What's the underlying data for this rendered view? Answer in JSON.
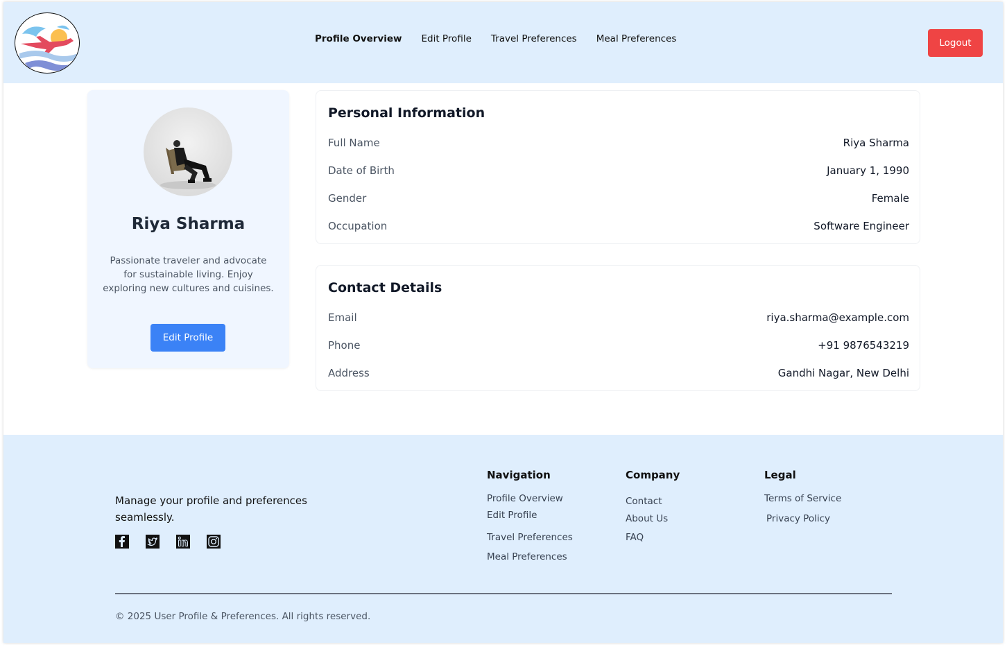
{
  "header": {
    "nav": [
      {
        "label": "Profile Overview",
        "active": true
      },
      {
        "label": "Edit Profile",
        "active": false
      },
      {
        "label": "Travel Preferences",
        "active": false
      },
      {
        "label": "Meal Preferences",
        "active": false
      }
    ],
    "logout_label": "Logout"
  },
  "profile": {
    "name": "Riya Sharma",
    "bio": "Passionate traveler and advocate for sustainable living. Enjoy exploring new cultures and cuisines.",
    "edit_button": "Edit Profile"
  },
  "personal": {
    "title": "Personal Information",
    "rows": [
      {
        "label": "Full Name",
        "value": "Riya Sharma"
      },
      {
        "label": "Date of Birth",
        "value": "January 1, 1990"
      },
      {
        "label": "Gender",
        "value": "Female"
      },
      {
        "label": "Occupation",
        "value": "Software Engineer"
      }
    ]
  },
  "contact": {
    "title": "Contact Details",
    "rows": [
      {
        "label": "Email",
        "value": "riya.sharma@example.com"
      },
      {
        "label": "Phone",
        "value": "+91 9876543219"
      },
      {
        "label": "Address",
        "value": "Gandhi Nagar, New Delhi"
      }
    ]
  },
  "footer": {
    "tagline": "Manage your profile and preferences seamlessly.",
    "socials": [
      "facebook-icon",
      "twitter-icon",
      "linkedin-icon",
      "instagram-icon"
    ],
    "navigation": {
      "title": "Navigation",
      "links": [
        "Profile Overview",
        "Edit Profile",
        "Travel Preferences",
        "Meal Preferences"
      ]
    },
    "company": {
      "title": "Company",
      "links": [
        "Contact",
        "About Us",
        "FAQ"
      ]
    },
    "legal": {
      "title": "Legal",
      "links": [
        "Terms of Service",
        "Privacy Policy"
      ]
    },
    "copyright": "© 2025 User Profile & Preferences. All rights reserved."
  },
  "colors": {
    "header_bg": "#dfeefd",
    "logout": "#ef4444",
    "primary": "#3b82f6",
    "card_bg": "#f0f6ff"
  }
}
